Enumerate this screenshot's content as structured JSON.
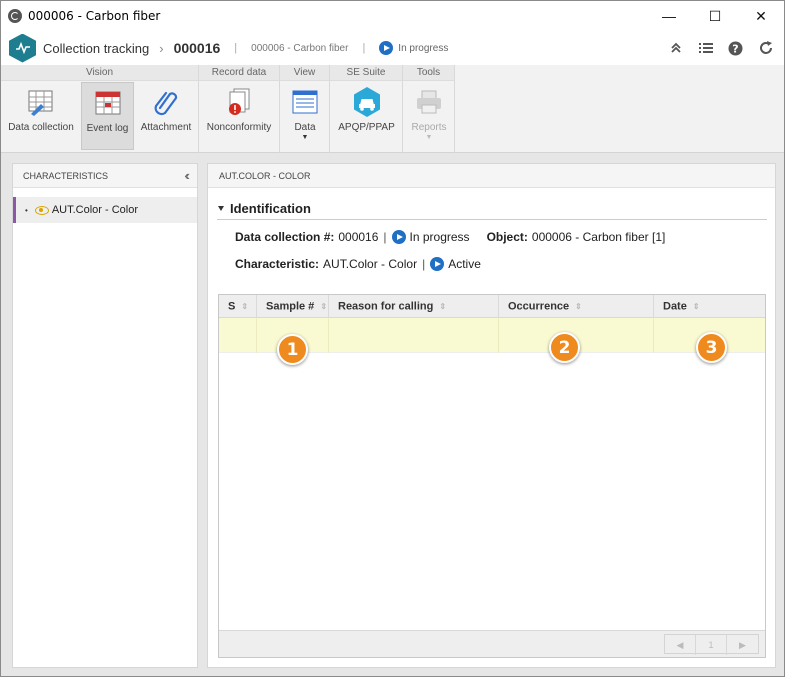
{
  "window": {
    "title": "000006 - Carbon fiber",
    "minimize": "—",
    "maximize": "☐",
    "close": "✕"
  },
  "header": {
    "module": "Collection tracking",
    "record_id": "000016",
    "separator": "|",
    "object": "000006 - Carbon fiber",
    "status": "In progress"
  },
  "ribbon": {
    "groups": [
      {
        "label": "Vision",
        "buttons": [
          "Data collection",
          "Event log",
          "Attachment"
        ]
      },
      {
        "label": "Record data",
        "buttons": [
          "Nonconformity"
        ]
      },
      {
        "label": "View",
        "buttons": [
          "Data"
        ]
      },
      {
        "label": "SE Suite",
        "buttons": [
          "APQP/PPAP"
        ]
      },
      {
        "label": "Tools",
        "buttons": [
          "Reports"
        ]
      }
    ]
  },
  "left_panel": {
    "title": "CHARACTERISTICS",
    "items": [
      {
        "label": "AUT.Color - Color"
      }
    ]
  },
  "right_panel": {
    "title": "AUT.COLOR - COLOR",
    "section": "Identification",
    "info": {
      "collection_label": "Data collection #:",
      "collection_value": "000016",
      "collection_status": "In progress",
      "object_label": "Object:",
      "object_value": "000006 - Carbon fiber [1]",
      "characteristic_label": "Characteristic:",
      "characteristic_value": "AUT.Color - Color",
      "characteristic_status": "Active",
      "pipe": "|"
    },
    "grid": {
      "columns": [
        "S",
        "Sample #",
        "Reason for calling",
        "Occurrence",
        "Date"
      ],
      "badges": [
        "1",
        "2",
        "3"
      ],
      "pager": {
        "prev": "◀",
        "page": "1",
        "next": "▶"
      }
    }
  },
  "colors": {
    "accent": "#1e7e8f",
    "status_blue": "#1f6fc5",
    "badge_orange": "#ef8a1e",
    "selected_row": "#fafad2",
    "char_marker": "#8a58a5"
  }
}
